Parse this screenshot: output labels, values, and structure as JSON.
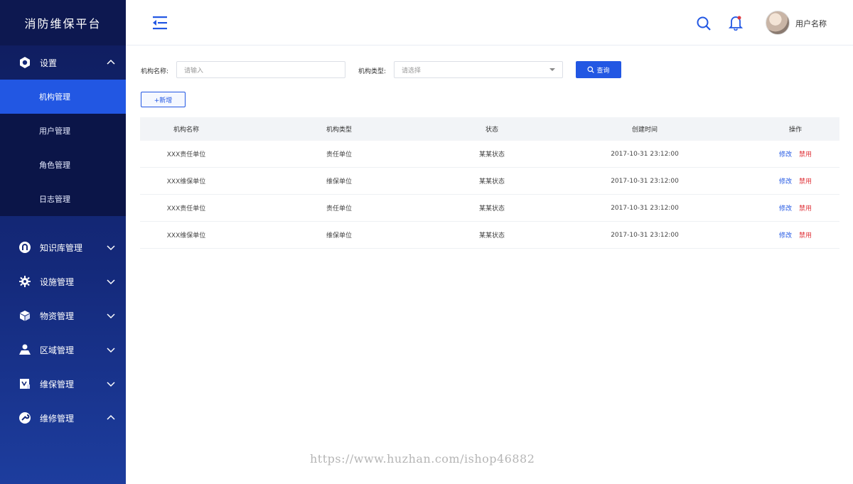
{
  "app": {
    "title": "消防维保平台"
  },
  "colors": {
    "accent": "#2257e3",
    "danger": "#e0383e",
    "sidebar": "#14297a"
  },
  "sidebar": {
    "groups": [
      {
        "label": "设置",
        "icon": "gear-hex-icon",
        "expanded": true,
        "children": [
          {
            "label": "机构管理",
            "active": true
          },
          {
            "label": "用户管理"
          },
          {
            "label": "角色管理"
          },
          {
            "label": "日志管理"
          }
        ]
      },
      {
        "label": "知识库管理",
        "icon": "knowledge-icon"
      },
      {
        "label": "设施管理",
        "icon": "cog-icon"
      },
      {
        "label": "物资管理",
        "icon": "cube-icon"
      },
      {
        "label": "区域管理",
        "icon": "map-user-icon"
      },
      {
        "label": "维保管理",
        "icon": "maintenance-doc-icon"
      },
      {
        "label": "维修管理",
        "icon": "wrench-icon"
      }
    ]
  },
  "header": {
    "username": "用户名称"
  },
  "filters": {
    "name_label": "机构名称:",
    "name_placeholder": "请输入",
    "type_label": "机构类型:",
    "type_placeholder": "请选择",
    "query_label": "查询"
  },
  "actions": {
    "add_label": "+新增"
  },
  "table": {
    "columns": [
      "机构名称",
      "机构类型",
      "状态",
      "创建时间",
      "操作"
    ],
    "rows": [
      {
        "name": "XXX责任单位",
        "type": "责任单位",
        "status": "某某状态",
        "created": "2017-10-31  23:12:00",
        "edit": "修改",
        "disable": "禁用"
      },
      {
        "name": "XXX维保单位",
        "type": "维保单位",
        "status": "某某状态",
        "created": "2017-10-31  23:12:00",
        "edit": "修改",
        "disable": "禁用"
      },
      {
        "name": "XXX责任单位",
        "type": "责任单位",
        "status": "某某状态",
        "created": "2017-10-31  23:12:00",
        "edit": "修改",
        "disable": "禁用"
      },
      {
        "name": "XXX维保单位",
        "type": "维保单位",
        "status": "某某状态",
        "created": "2017-10-31  23:12:00",
        "edit": "修改",
        "disable": "禁用"
      }
    ]
  },
  "watermark": "https://www.huzhan.com/ishop46882"
}
